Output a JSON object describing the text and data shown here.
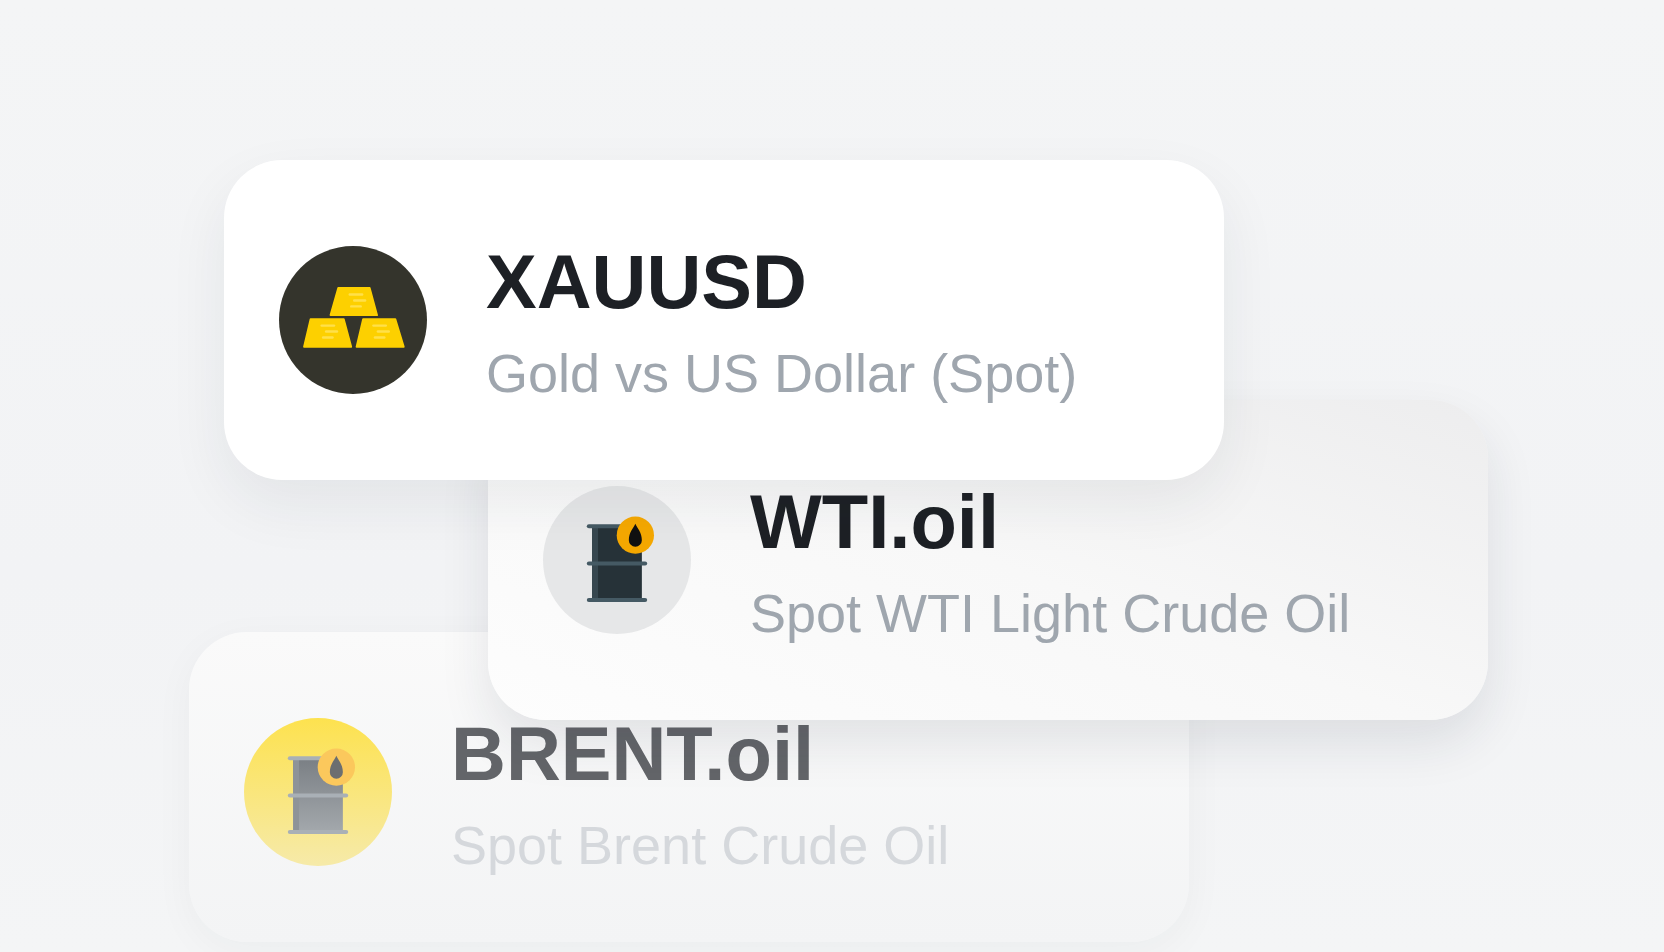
{
  "cards": [
    {
      "kind": "gold",
      "symbol": "XAUUSD",
      "description": "Gold vs US Dollar (Spot)",
      "faded": false
    },
    {
      "kind": "oil",
      "symbol": "WTI.oil",
      "description": "Spot WTI Light Crude Oil",
      "faded": false
    },
    {
      "kind": "oil",
      "symbol": "BRENT.oil",
      "description": "Spot Brent Crude Oil",
      "faded": true
    }
  ]
}
